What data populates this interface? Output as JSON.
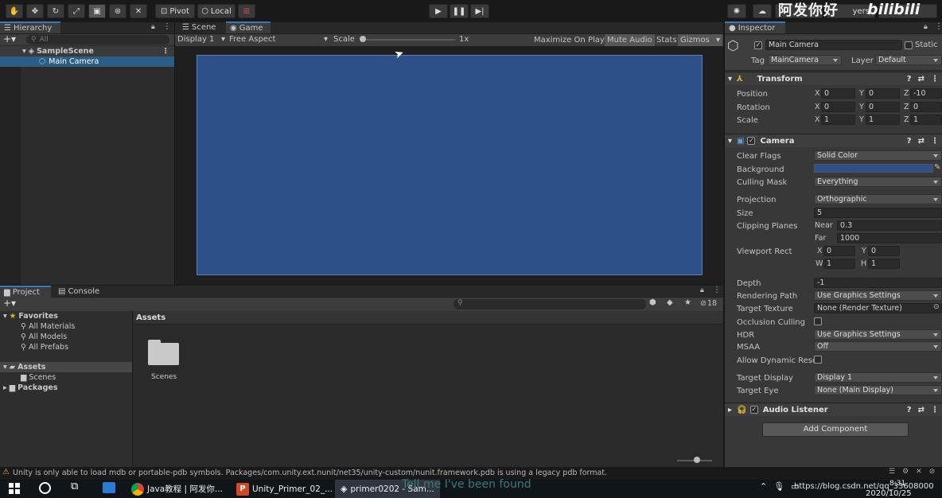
{
  "toolbar": {
    "pivot": "Pivot",
    "local": "Local",
    "watermark": "阿发你好",
    "bili": "bilibili",
    "layers": "yers",
    "layout": "out"
  },
  "hierarchy": {
    "tab": "Hierarchy",
    "search_placeholder": "All",
    "scene": "SampleScene",
    "item": "Main Camera"
  },
  "game": {
    "scene_tab": "Scene",
    "game_tab": "Game",
    "display": "Display 1",
    "aspect": "Free Aspect",
    "scale_label": "Scale",
    "scale_value": "1x",
    "maximize": "Maximize On Play",
    "mute": "Mute Audio",
    "stats": "Stats",
    "gizmos": "Gizmos",
    "background_color": "#2e5089"
  },
  "project": {
    "project_tab": "Project",
    "console_tab": "Console",
    "hidden_count": "18",
    "favorites": "Favorites",
    "fav_items": [
      "All Materials",
      "All Models",
      "All Prefabs"
    ],
    "assets": "Assets",
    "scenes": "Scenes",
    "packages": "Packages",
    "breadcrumb": "Assets",
    "folder_label": "Scenes"
  },
  "status": {
    "warning": "Unity is only able to load mdb or portable-pdb symbols. Packages/com.unity.ext.nunit/net35/unity-custom/nunit.framework.pdb is using a legacy pdb format."
  },
  "inspector": {
    "tab": "Inspector",
    "object_name": "Main Camera",
    "static_label": "Static",
    "tag_label": "Tag",
    "tag_value": "MainCamera",
    "layer_label": "Layer",
    "layer_value": "Default",
    "transform": {
      "title": "Transform",
      "position_label": "Position",
      "px": "0",
      "py": "0",
      "pz": "-10",
      "rotation_label": "Rotation",
      "rx": "0",
      "ry": "0",
      "rz": "0",
      "scale_label": "Scale",
      "sx": "1",
      "sy": "1",
      "sz": "1"
    },
    "camera": {
      "title": "Camera",
      "clear_flags_label": "Clear Flags",
      "clear_flags": "Solid Color",
      "background_label": "Background",
      "culling_label": "Culling Mask",
      "culling": "Everything",
      "projection_label": "Projection",
      "projection": "Orthographic",
      "size_label": "Size",
      "size": "5",
      "clipping_label": "Clipping Planes",
      "near_label": "Near",
      "near": "0.3",
      "far_label": "Far",
      "far": "1000",
      "viewport_label": "Viewport Rect",
      "vx": "0",
      "vy": "0",
      "vw": "1",
      "vh": "1",
      "depth_label": "Depth",
      "depth": "-1",
      "rendering_label": "Rendering Path",
      "rendering": "Use Graphics Settings",
      "target_texture_label": "Target Texture",
      "target_texture": "None (Render Texture)",
      "occlusion_label": "Occlusion Culling",
      "hdr_label": "HDR",
      "hdr": "Use Graphics Settings",
      "msaa_label": "MSAA",
      "msaa": "Off",
      "dynres_label": "Allow Dynamic Reso",
      "target_display_label": "Target Display",
      "target_display": "Display 1",
      "target_eye_label": "Target Eye",
      "target_eye": "None (Main Display)"
    },
    "audio": {
      "title": "Audio Listener"
    },
    "add_component": "Add Component"
  },
  "taskbar": {
    "chrome": "Java教程 | 阿发你...",
    "ppt": "Unity_Primer_02_...",
    "unity": "primer0202 - Sam...",
    "search_overlay": "Tell me I've been found",
    "url_overlay": "https://blog.csdn.net/qq_33608000",
    "time": "8:31",
    "date": "2020/10/25"
  }
}
